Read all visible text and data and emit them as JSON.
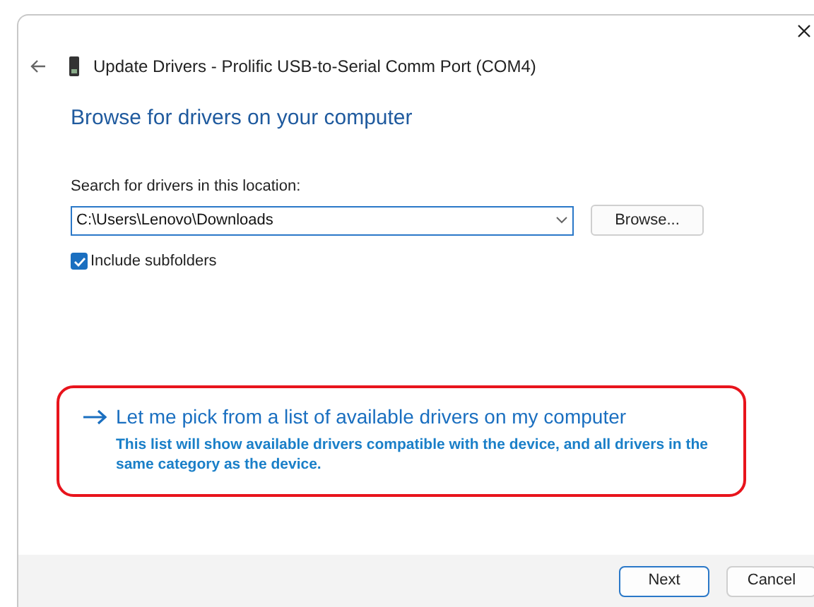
{
  "window": {
    "title": "Update Drivers - Prolific USB-to-Serial Comm Port (COM4)"
  },
  "heading": "Browse for drivers on your computer",
  "search": {
    "label": "Search for drivers in this location:",
    "value": "C:\\Users\\Lenovo\\Downloads",
    "browse_button": "Browse..."
  },
  "include_subfolders": {
    "label": "Include subfolders",
    "checked": true
  },
  "pick_option": {
    "title": "Let me pick from a list of available drivers on my computer",
    "description": "This list will show available drivers compatible with the device, and all drivers in the same category as the device.",
    "highlighted": true
  },
  "buttons": [
    {
      "label": "Next",
      "kind": "primary"
    },
    {
      "label": "Cancel",
      "kind": "secondary"
    }
  ]
}
